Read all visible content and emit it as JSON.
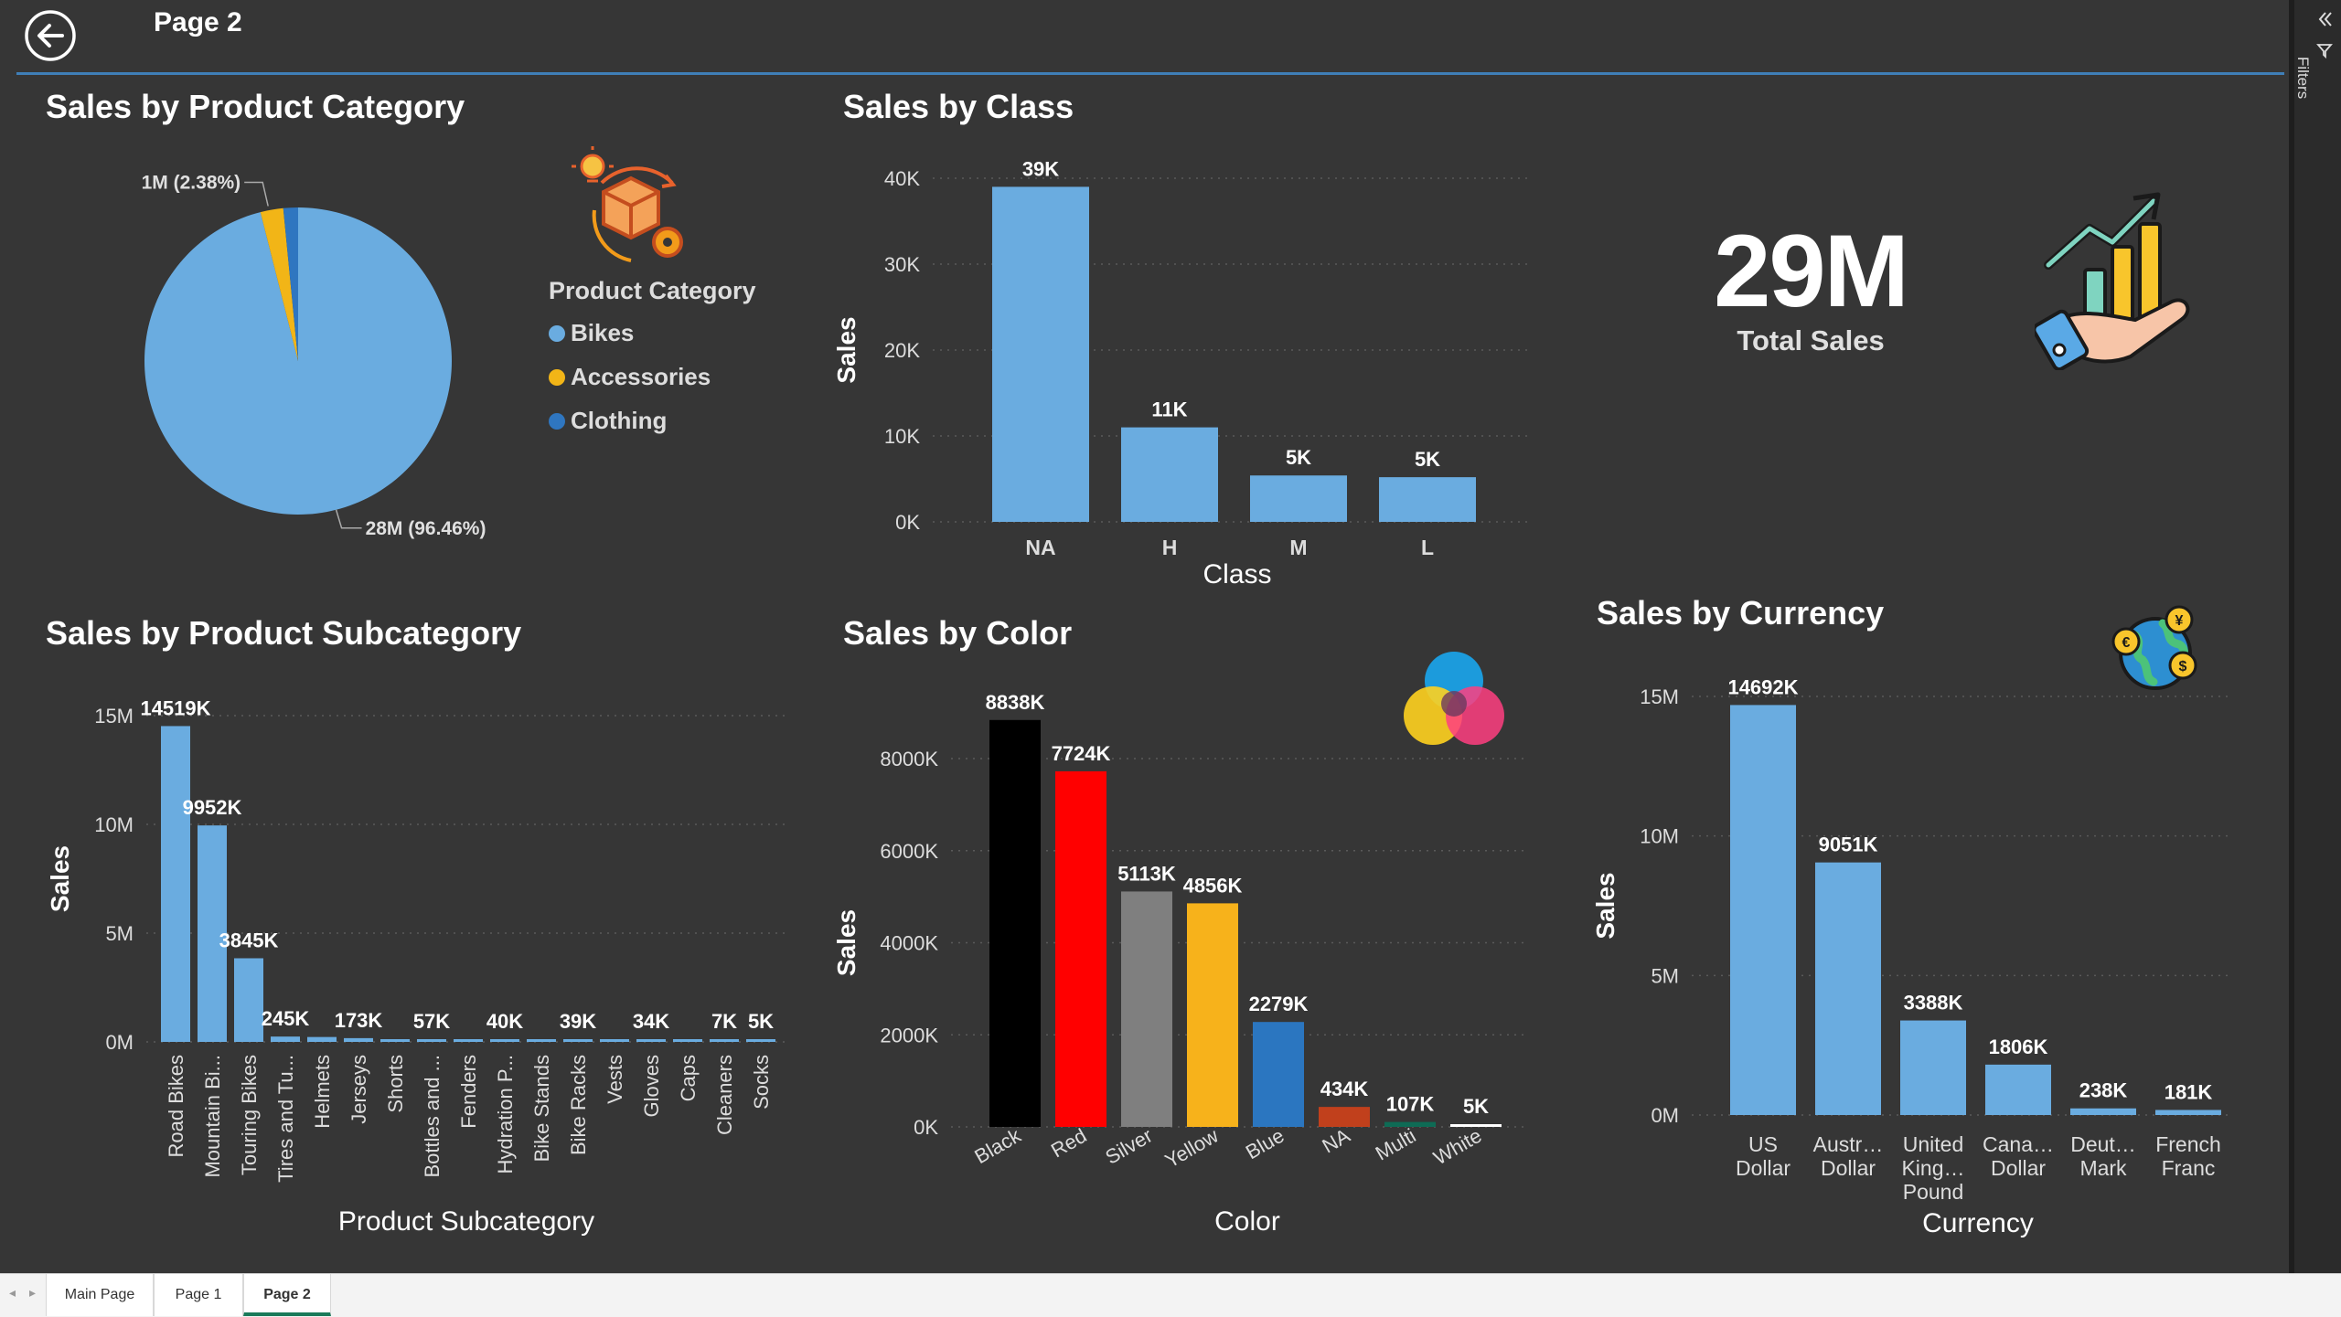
{
  "header": {
    "page_title": "Page 2"
  },
  "kpi": {
    "value": "29M",
    "label": "Total Sales"
  },
  "filters_pane": {
    "label": "Filters"
  },
  "tabs": [
    {
      "label": "Main Page",
      "active": false
    },
    {
      "label": "Page 1",
      "active": false
    },
    {
      "label": "Page 2",
      "active": true
    }
  ],
  "colors": {
    "bar": "#6aace0",
    "canvas": "#363636",
    "accent_line": "#3f7fb8"
  },
  "chart_data": [
    {
      "id": "category",
      "type": "pie",
      "title": "Sales by Product Category",
      "legend_title": "Product Category",
      "categories": [
        "Bikes",
        "Accessories",
        "Clothing"
      ],
      "values": [
        28,
        0.7,
        0.45
      ],
      "colors": [
        "#6aace0",
        "#f2b517",
        "#2f76c0"
      ],
      "labels": [
        "28M (96.46%)",
        "1M (2.38%)",
        ""
      ]
    },
    {
      "id": "class",
      "type": "bar",
      "title": "Sales by Class",
      "xlabel": "Class",
      "ylabel": "Sales",
      "categories": [
        "NA",
        "H",
        "M",
        "L"
      ],
      "values": [
        39000,
        11000,
        5400,
        5200
      ],
      "data_labels": [
        "39K",
        "11K",
        "5K",
        "5K"
      ],
      "ylim": [
        0,
        40000
      ],
      "yticks": [
        0,
        10000,
        20000,
        30000,
        40000
      ],
      "ytick_labels": [
        "0K",
        "10K",
        "20K",
        "30K",
        "40K"
      ]
    },
    {
      "id": "subcategory",
      "type": "bar",
      "title": "Sales by Product Subcategory",
      "xlabel": "Product Subcategory",
      "ylabel": "Sales",
      "categories": [
        "Road Bikes",
        "Mountain Bi...",
        "Touring Bikes",
        "Tires and Tu...",
        "Helmets",
        "Jerseys",
        "Shorts",
        "Bottles and ...",
        "Fenders",
        "Hydration P...",
        "Bike Stands",
        "Bike Racks",
        "Vests",
        "Gloves",
        "Caps",
        "Cleaners",
        "Socks"
      ],
      "values": [
        14519,
        9952,
        3845,
        245,
        225,
        173,
        72,
        57,
        46,
        40,
        39,
        39,
        36,
        34,
        20,
        7,
        5
      ],
      "data_labels": [
        "14519K",
        "9952K",
        "3845K",
        "245K",
        "",
        "173K",
        "",
        "57K",
        "",
        "40K",
        "",
        "39K",
        "",
        "34K",
        "",
        "7K",
        "5K"
      ],
      "ylim": [
        0,
        15000
      ],
      "yticks": [
        0,
        5000,
        10000,
        15000
      ],
      "ytick_labels": [
        "0M",
        "5M",
        "10M",
        "15M"
      ]
    },
    {
      "id": "color",
      "type": "bar",
      "title": "Sales by Color",
      "xlabel": "Color",
      "ylabel": "Sales",
      "categories": [
        "Black",
        "Red",
        "Silver",
        "Yellow",
        "Blue",
        "NA",
        "Multi",
        "White"
      ],
      "values": [
        8838,
        7724,
        5113,
        4856,
        2279,
        434,
        107,
        5
      ],
      "bar_colors": [
        "#000000",
        "#ff0000",
        "#7f7f7f",
        "#f7b21b",
        "#2b76c0",
        "#c1401c",
        "#0e6b55",
        "#ffffff"
      ],
      "data_labels": [
        "8838K",
        "7724K",
        "5113K",
        "4856K",
        "2279K",
        "434K",
        "107K",
        "5K"
      ],
      "ylim": [
        0,
        8000
      ],
      "yticks": [
        0,
        2000,
        4000,
        6000,
        8000
      ],
      "ytick_labels": [
        "0K",
        "2000K",
        "4000K",
        "6000K",
        "8000K"
      ]
    },
    {
      "id": "currency",
      "type": "bar",
      "title": "Sales by Currency",
      "xlabel": "Currency",
      "ylabel": "Sales",
      "categories": [
        "US Dollar",
        "Austr... Dollar",
        "United King... Pound",
        "Cana... Dollar",
        "Deut... Mark",
        "French Franc"
      ],
      "category_lines": [
        [
          "US",
          "Dollar"
        ],
        [
          "Austr…",
          "Dollar"
        ],
        [
          "United",
          "King…",
          "Pound"
        ],
        [
          "Cana…",
          "Dollar"
        ],
        [
          "Deut…",
          "Mark"
        ],
        [
          "French",
          "Franc"
        ]
      ],
      "values": [
        14692,
        9051,
        3388,
        1806,
        238,
        181
      ],
      "data_labels": [
        "14692K",
        "9051K",
        "3388K",
        "1806K",
        "238K",
        "181K"
      ],
      "ylim": [
        0,
        15000
      ],
      "yticks": [
        0,
        5000,
        10000,
        15000
      ],
      "ytick_labels": [
        "0M",
        "5M",
        "10M",
        "15M"
      ]
    }
  ]
}
